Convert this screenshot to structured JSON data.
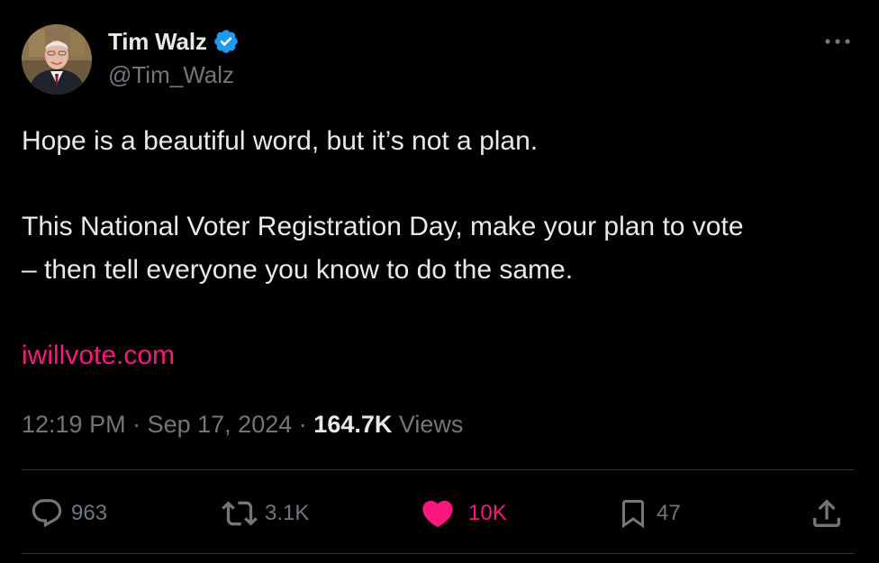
{
  "author": {
    "display_name": "Tim Walz",
    "handle": "@Tim_Walz",
    "verified": true,
    "verified_color": "#1d9bf0"
  },
  "tweet": {
    "paragraph1": "Hope is a beautiful word, but it’s not a plan.",
    "paragraph2_line1": "This National Voter Registration Day, make your plan to vote",
    "paragraph2_line2": "– then tell everyone you know to do the same.",
    "link_text": "iwillvote.com",
    "link_color": "#f91880"
  },
  "meta": {
    "time": "12:19 PM",
    "separator": "·",
    "date": "Sep 17, 2024",
    "views_count": "164.7K",
    "views_label": "Views"
  },
  "actions": {
    "replies": "963",
    "reposts": "3.1K",
    "likes": "10K",
    "likes_active": true,
    "bookmarks": "47"
  },
  "icons": {
    "more": "more-horizontal-icon",
    "reply": "reply-bubble-icon",
    "repost": "repost-arrows-icon",
    "like": "heart-icon",
    "bookmark": "bookmark-icon",
    "share": "share-upload-icon"
  },
  "colors": {
    "background": "#000000",
    "text_primary": "#e7e9ea",
    "text_secondary": "#71767b",
    "divider": "#2f3336",
    "like_active": "#f91880"
  }
}
